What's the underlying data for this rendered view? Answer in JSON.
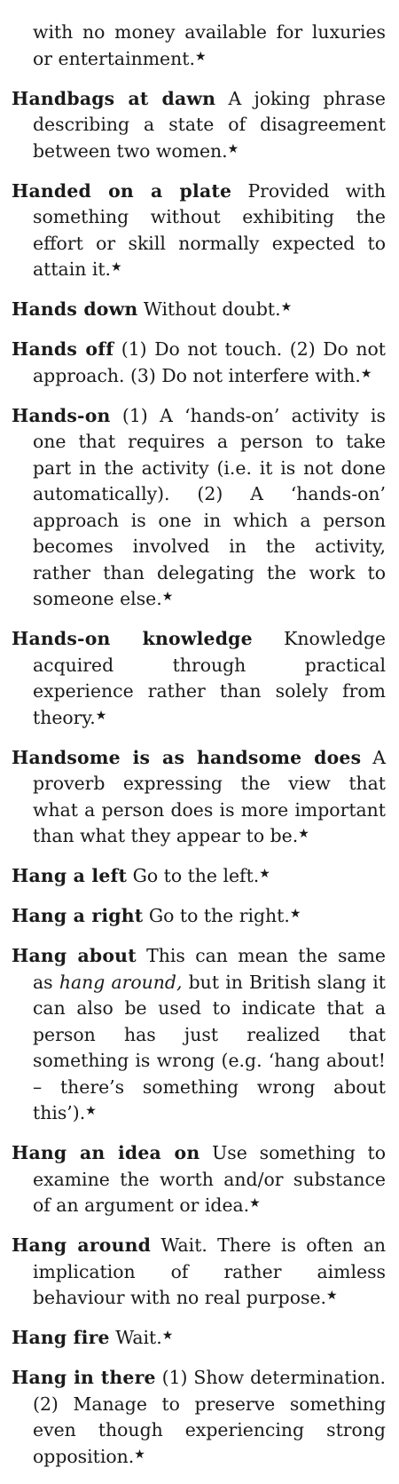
{
  "entries": [
    {
      "continuation": true,
      "headword": "",
      "parts": [
        {
          "t": "with no money available for luxuries or entertainment."
        }
      ]
    },
    {
      "headword": "Handbags at dawn",
      "parts": [
        {
          "t": "A joking phrase describing a state of disagreement between two women."
        }
      ]
    },
    {
      "headword": "Handed on a plate",
      "parts": [
        {
          "t": "Provided with some­thing without exhibiting the effort or skill normally expected to attain it."
        }
      ]
    },
    {
      "headword": "Hands down",
      "parts": [
        {
          "t": "Without doubt."
        }
      ]
    },
    {
      "headword": "Hands off",
      "parts": [
        {
          "t": "(1) Do not touch. (2) Do not approach. (3) Do not interfere with."
        }
      ]
    },
    {
      "headword": "Hands-on",
      "parts": [
        {
          "t": "(1) A ‘hands-on’ activity is one that requires a person to take part in the activity (i.e. it is not done automatically). (2) A ‘hands-on’ approach is one in which a person becomes involved in the activity, rather than delegating the work to someone else."
        }
      ]
    },
    {
      "headword": "Hands-on knowledge",
      "parts": [
        {
          "t": "Knowledge acqu­ired through practical experience rather than solely from theory."
        }
      ]
    },
    {
      "headword": "Handsome is as handsome does",
      "parts": [
        {
          "t": "A proverb expressing the view that what a person does is more important than what they appear to be."
        }
      ]
    },
    {
      "headword": "Hang a left",
      "parts": [
        {
          "t": "Go to the left."
        }
      ]
    },
    {
      "headword": "Hang a right",
      "parts": [
        {
          "t": "Go to the right."
        }
      ]
    },
    {
      "headword": "Hang about",
      "parts": [
        {
          "t": "This can mean the same as "
        },
        {
          "t": "hang around,",
          "i": true
        },
        {
          "t": " but in British slang it can also be used to indicate that a person has just realized that something is wrong (e.g. ‘hang about! – there’s something wrong about this’)."
        }
      ]
    },
    {
      "headword": "Hang an idea on",
      "parts": [
        {
          "t": "Use something to examine the worth and/or substance of an argument or idea."
        }
      ]
    },
    {
      "headword": "Hang around",
      "parts": [
        {
          "t": "Wait. There is often an implication of rather aimless behaviour with no real purpose."
        }
      ]
    },
    {
      "headword": "Hang fire",
      "parts": [
        {
          "t": "Wait."
        }
      ]
    },
    {
      "headword": "Hang in there",
      "parts": [
        {
          "t": "(1) Show determination. (2) Manage to preserve something even though experiencing strong opposition."
        }
      ]
    }
  ],
  "marker": "★"
}
